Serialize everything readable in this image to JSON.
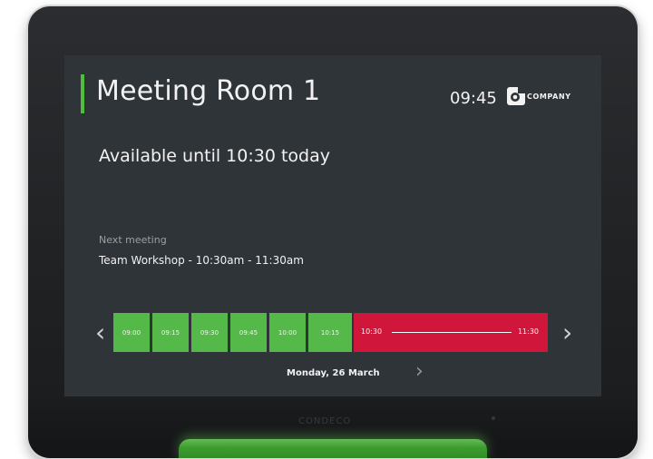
{
  "room": {
    "name": "Meeting Room 1",
    "clock": "09:45",
    "company": "COMPANY",
    "logo_icon": "company-logo-icon",
    "status": "Available until 10:30 today"
  },
  "next": {
    "label": "Next meeting",
    "meeting": "Team Workshop - 10:30am - 11:30am"
  },
  "timeline": {
    "free_slots": [
      "09:00",
      "09:15",
      "09:30",
      "09:45",
      "10:00",
      "10:15"
    ],
    "booked": {
      "start": "10:30",
      "end": "11:30"
    },
    "prev_icon": "chevron-left-icon",
    "next_icon": "chevron-right-icon"
  },
  "date": {
    "label": "Monday, 26 March",
    "next_icon": "chevron-right-icon"
  },
  "device": {
    "brand": "CONDECO"
  },
  "colors": {
    "available": "#54b948",
    "booked": "#d0163a",
    "accent": "#4fbf3a",
    "screen_bg": "#2f3439"
  }
}
